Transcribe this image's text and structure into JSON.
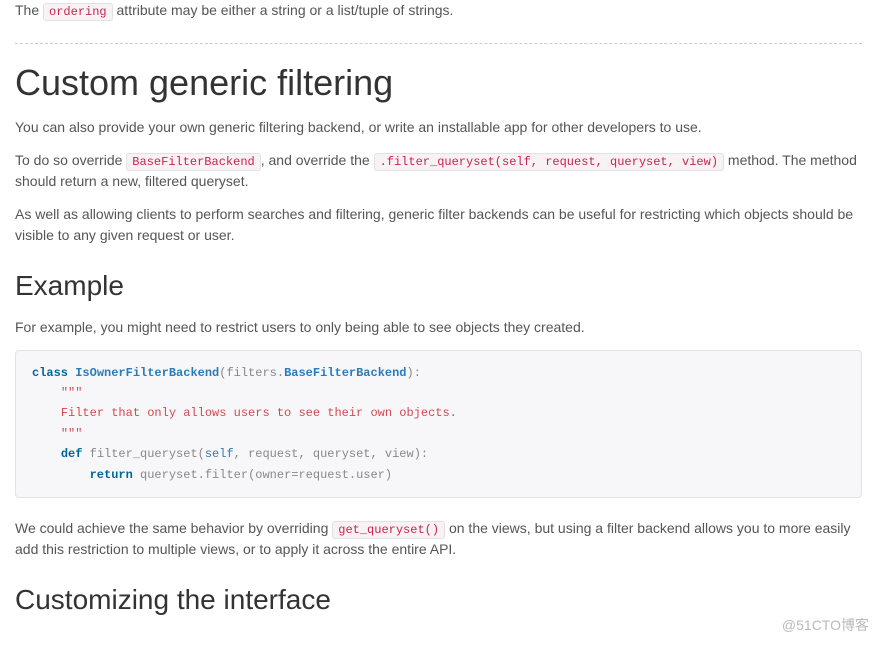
{
  "top": {
    "pre": "The ",
    "code": "ordering",
    "post": " attribute may be either a string or a list/tuple of strings."
  },
  "h1": "Custom generic filtering",
  "p1": "You can also provide your own generic filtering backend, or write an installable app for other developers to use.",
  "p2": {
    "a": "To do so override ",
    "code1": "BaseFilterBackend",
    "b": ", and override the ",
    "code2": ".filter_queryset(self, request, queryset, view)",
    "c": " method. The method should return a new, filtered queryset."
  },
  "p3": "As well as allowing clients to perform searches and filtering, generic filter backends can be useful for restricting which objects should be visible to any given request or user.",
  "h2a": "Example",
  "p4": "For example, you might need to restrict users to only being able to see objects they created.",
  "code": {
    "l1": {
      "kw": "class",
      "cls": "IsOwnerFilterBackend",
      "p1": "(",
      "mod": "filters",
      "dot": ".",
      "base": "BaseFilterBackend",
      "p2": "):"
    },
    "l2": "\"\"\"",
    "l3": "Filter that only allows users to see their own objects.",
    "l4": "\"\"\"",
    "l5": {
      "kw": "def",
      "fn": "filter_queryset",
      "p1": "(",
      "self": "self",
      "rest": ", request, queryset, view",
      "p2": "):"
    },
    "l6": {
      "kw": "return",
      "expr1": " queryset",
      "dot1": ".",
      "m1": "filter",
      "p1": "(",
      "arg1": "owner",
      "eq": "=",
      "arg2": "request",
      "dot2": ".",
      "arg3": "user",
      "p2": ")"
    }
  },
  "p5": {
    "a": "We could achieve the same behavior by overriding ",
    "code": "get_queryset()",
    "b": " on the views, but using a filter backend allows you to more easily add this restriction to multiple views, or to apply it across the entire API."
  },
  "h2b": "Customizing the interface",
  "watermark": "@51CTO博客"
}
